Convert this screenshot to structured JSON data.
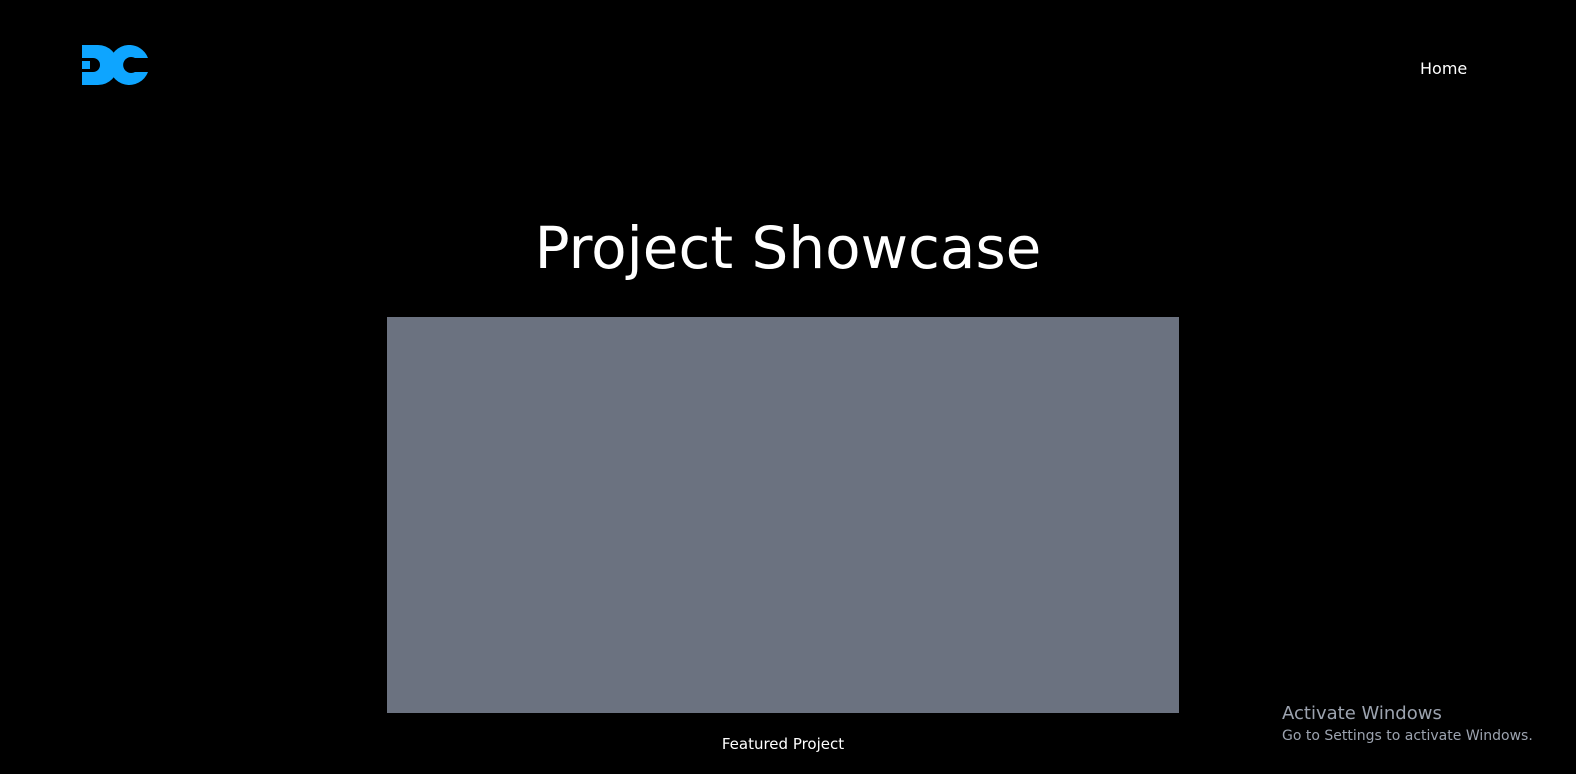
{
  "navbar": {
    "logo_color": "#0ea5ff",
    "home_label": "Home"
  },
  "main": {
    "title": "Project Showcase",
    "image_placeholder_color": "#6b7280",
    "caption": "Featured Project"
  },
  "watermark": {
    "title": "Activate Windows",
    "subtitle": "Go to Settings to activate Windows."
  }
}
